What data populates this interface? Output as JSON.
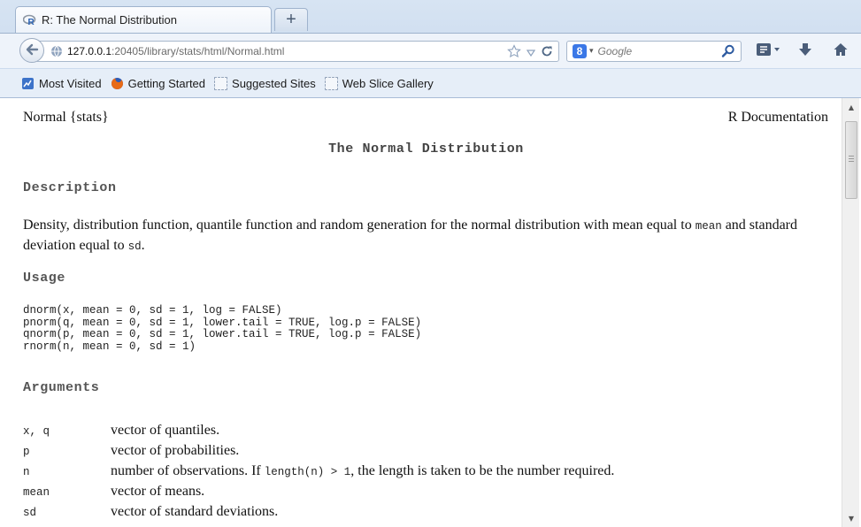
{
  "browser": {
    "tab_title": "R: The Normal Distribution",
    "new_tab_label": "+",
    "url_host": "127.0.0.1",
    "url_path": ":20405/library/stats/html/Normal.html",
    "search_placeholder": "Google",
    "bookmarks": [
      {
        "label": "Most Visited",
        "icon": "most-visited-icon"
      },
      {
        "label": "Getting Started",
        "icon": "firefox-icon"
      },
      {
        "label": "Suggested Sites",
        "icon": "page-icon"
      },
      {
        "label": "Web Slice Gallery",
        "icon": "page-icon"
      }
    ],
    "colors": {
      "chrome": "#c6d7ec",
      "accent": "#3b78e7"
    }
  },
  "doc": {
    "topic": "Normal {stats}",
    "source": "R Documentation",
    "title": "The Normal Distribution",
    "description_heading": "Description",
    "description": {
      "part1": "Density, distribution function, quantile function and random generation for the normal distribution with mean equal to",
      "code1": "mean",
      "part2": "and standard deviation equal to",
      "code2": "sd",
      "part3": "."
    },
    "usage_heading": "Usage",
    "usage": [
      "dnorm(x, mean = 0, sd = 1, log = FALSE)",
      "pnorm(q, mean = 0, sd = 1, lower.tail = TRUE, log.p = FALSE)",
      "qnorm(p, mean = 0, sd = 1, lower.tail = TRUE, log.p = FALSE)",
      "rnorm(n, mean = 0, sd = 1)"
    ],
    "arguments_heading": "Arguments",
    "arguments": [
      {
        "name": "x, q",
        "desc": "vector of quantiles."
      },
      {
        "name": "p",
        "desc": "vector of probabilities."
      },
      {
        "name": "n",
        "desc_pre": "number of observations. If",
        "desc_code": "length(n) > 1",
        "desc_post": ", the length is taken to be the number required."
      },
      {
        "name": "mean",
        "desc": "vector of means."
      },
      {
        "name": "sd",
        "desc": "vector of standard deviations."
      }
    ]
  }
}
